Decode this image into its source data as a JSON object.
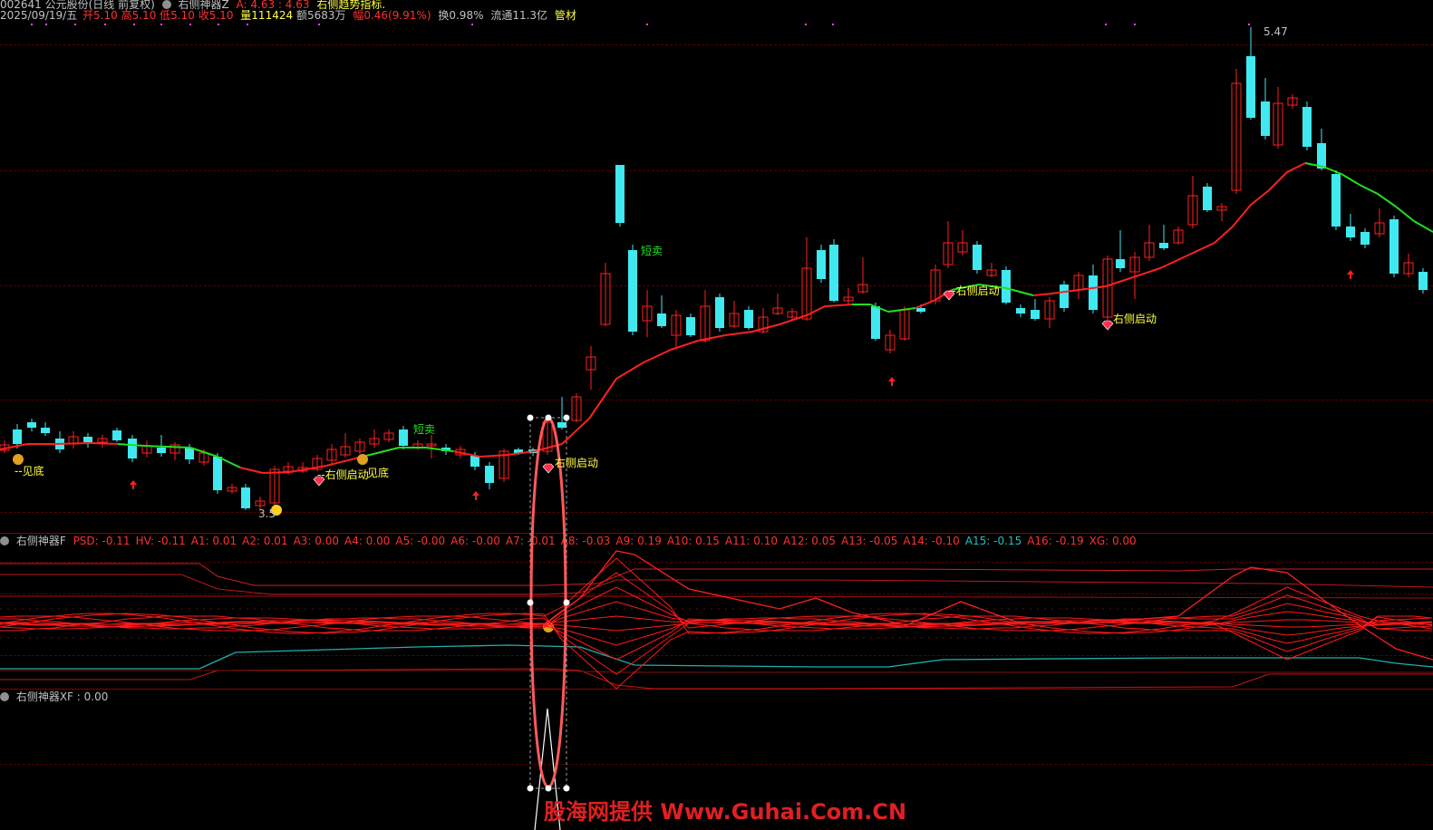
{
  "header": {
    "line1": {
      "stock": "002641 公元股份(日线 前复权)",
      "indicator": "右侧神器Z",
      "a_label": "A: 4.63 : 4.63",
      "desc": "右侧趋势指标."
    },
    "line2": {
      "date": "2025/09/19/五",
      "open": "开5.10",
      "high": "高5.10",
      "low": "低5.10",
      "close": "收5.10",
      "volume": "量111424",
      "amount": "额5683万",
      "change": "幅0.46(9.91%)",
      "turnover": "换0.98%",
      "float": "流通11.3亿",
      "sector": "管材"
    }
  },
  "panel2": {
    "title": "右侧神器F",
    "values": [
      {
        "label": "PSD: -0.11",
        "color": "#ff3030"
      },
      {
        "label": "HV: -0.11",
        "color": "#ff3030"
      },
      {
        "label": "A1: 0.01",
        "color": "#ff3030"
      },
      {
        "label": "A2: 0.01",
        "color": "#ff3030"
      },
      {
        "label": "A3: 0.00",
        "color": "#ff3030"
      },
      {
        "label": "A4: 0.00",
        "color": "#ff3030"
      },
      {
        "label": "A5: -0.00",
        "color": "#ff3030"
      },
      {
        "label": "A6: -0.00",
        "color": "#ff3030"
      },
      {
        "label": "A7: -0.01",
        "color": "#ff3030"
      },
      {
        "label": "A8: -0.03",
        "color": "#ff3030"
      },
      {
        "label": "A9: 0.19",
        "color": "#ff3030"
      },
      {
        "label": "A10: 0.15",
        "color": "#ff3030"
      },
      {
        "label": "A11: 0.10",
        "color": "#ff3030"
      },
      {
        "label": "A12: 0.05",
        "color": "#ff3030"
      },
      {
        "label": "A13: -0.05",
        "color": "#ff3030"
      },
      {
        "label": "A14: -0.10",
        "color": "#ff3030"
      },
      {
        "label": "A15: -0.15",
        "color": "#20c0c0"
      },
      {
        "label": "A16: -0.19",
        "color": "#ff3030"
      },
      {
        "label": "XG: 0.00",
        "color": "#ff3030"
      }
    ]
  },
  "panel3": {
    "title": "右侧神器XF",
    "value": ": 0.00"
  },
  "annotations": {
    "jiandi": "--见底",
    "jiandi2": "见底",
    "youce1": "--右侧启动",
    "youce2": "--右侧启动",
    "youce3": "右侧启动",
    "youce4": "右侧启动",
    "duanmai1": "短卖",
    "duanmai2": "短卖",
    "low_price": "3.5",
    "high_price": "5.47"
  },
  "watermark": "股海网提供 Www.Guhai.Com.CN",
  "chart_data": {
    "type": "candlestick",
    "ma_color_up": "#ff2020",
    "ma_color_down": "#20e020",
    "candle_up": "#ff2020",
    "candle_down": "#40e8f0"
  }
}
